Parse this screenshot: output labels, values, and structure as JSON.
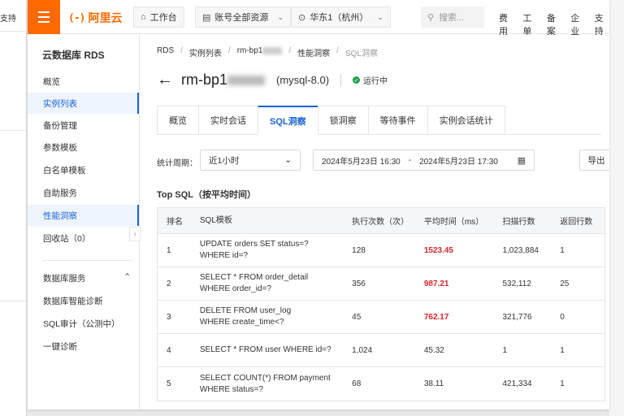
{
  "bg": {
    "left_fragment": "支持"
  },
  "topbar": {
    "logo_mark": "(-)",
    "logo_text": "阿里云",
    "workbench": "工作台",
    "account": "账号全部资源",
    "region": "华东1（杭州）",
    "search_placeholder": "搜索...",
    "links": [
      "费用",
      "工单",
      "备案",
      "企业",
      "支持"
    ]
  },
  "sidebar": {
    "title": "云数据库 RDS",
    "items": [
      {
        "label": "概览",
        "active": false
      },
      {
        "label": "实例列表",
        "active": true
      },
      {
        "label": "备份管理",
        "active": false
      },
      {
        "label": "参数模板",
        "active": false
      },
      {
        "label": "白名单模板",
        "active": false
      },
      {
        "label": "自助服务",
        "active": false
      },
      {
        "label": "性能洞察",
        "active": true
      },
      {
        "label": "回收站（0）",
        "active": false
      }
    ],
    "section": "数据库服务",
    "section_items": [
      "数据库智能诊断",
      "SQL审计（公测中）",
      "一键诊断"
    ]
  },
  "breadcrumb": {
    "items": [
      "RDS",
      "实例列表",
      "rm-bp1",
      "性能洞察",
      "SQL洞察"
    ]
  },
  "instance": {
    "name": "rm-bp1",
    "engine": "(mysql-8.0)",
    "status": "运行中",
    "status_color": "#22a34a"
  },
  "tabs": [
    "概览",
    "实时会话",
    "SQL洞察",
    "锁洞察",
    "等待事件",
    "实例会话统计"
  ],
  "active_tab": "SQL洞察",
  "filters": {
    "period_label": "统计周期：",
    "period_value": "近1小时",
    "start": "2024年5月23日 16:30",
    "dash": "-",
    "end": "2024年5月23日 17:30",
    "export": "导出"
  },
  "top_sql": {
    "title": "Top SQL（按平均时间）",
    "headers": [
      "排名",
      "SQL模板",
      "执行次数（次）",
      "平均时间（ms）",
      "扫描行数",
      "返回行数"
    ],
    "rows": [
      {
        "rank": "1",
        "sql1": "UPDATE orders SET status=?",
        "sql2": "WHERE id=?",
        "exec": "128",
        "avg": "1523.45",
        "scan": "1,023,884",
        "ret": "1",
        "highlight": true
      },
      {
        "rank": "2",
        "sql1": "SELECT * FROM order_detail",
        "sql2": "WHERE order_id=?",
        "exec": "356",
        "avg": "987.21",
        "scan": "532,112",
        "ret": "25",
        "highlight": true
      },
      {
        "rank": "3",
        "sql1": "DELETE FROM user_log",
        "sql2": "WHERE create_time<?",
        "exec": "45",
        "avg": "762.17",
        "scan": "321,776",
        "ret": "0",
        "highlight": true
      },
      {
        "rank": "4",
        "sql1": "SELECT * FROM user WHERE id=?",
        "sql2": "",
        "exec": "1,024",
        "avg": "45.32",
        "scan": "1",
        "ret": "1",
        "highlight": false
      },
      {
        "rank": "5",
        "sql1": "SELECT COUNT(*) FROM payment",
        "sql2": "WHERE status=?",
        "exec": "68",
        "avg": "38.11",
        "scan": "421,334",
        "ret": "1",
        "highlight": false
      }
    ],
    "highlight_color": "#d9262c"
  },
  "accent_color": "#1a63d6",
  "brand_color": "#ff6a00"
}
